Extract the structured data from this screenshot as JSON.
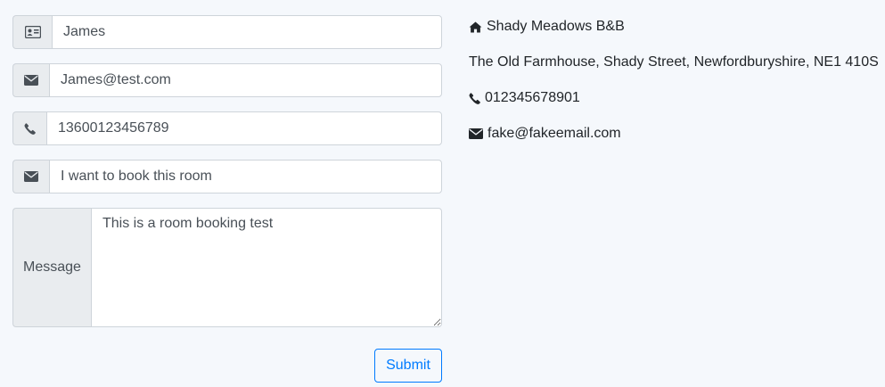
{
  "form": {
    "name_value": "James",
    "email_value": "James@test.com",
    "phone_value": "13600123456789",
    "subject_value": "I want to book this room",
    "message_label": "Message",
    "message_value": "This is a room booking test",
    "submit_label": "Submit"
  },
  "contact": {
    "name": "Shady Meadows B&B",
    "address": "The Old Farmhouse, Shady Street, Newfordburyshire, NE1 410S",
    "phone": "012345678901",
    "email": "fake@fakeemail.com"
  },
  "icons": {
    "name": "id-card-icon",
    "email": "envelope-icon",
    "phone": "phone-icon",
    "subject": "envelope-icon",
    "home": "home-icon"
  },
  "colors": {
    "background": "#f5f8fc",
    "accent": "#007bff",
    "addon_bg": "#e9ecef",
    "border": "#ced4da"
  }
}
